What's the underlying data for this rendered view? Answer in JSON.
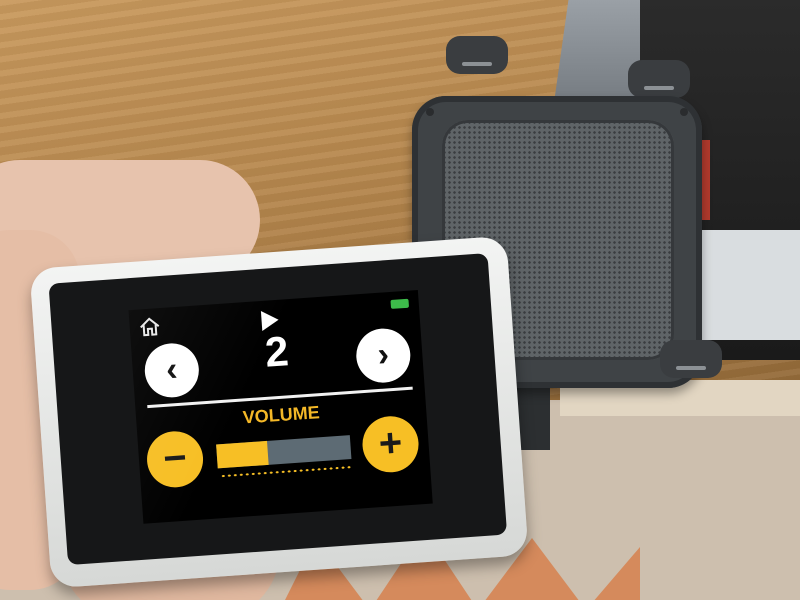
{
  "device_screen": {
    "track_number": "2",
    "volume_label": "VOLUME",
    "battery_label": "",
    "prev_symbol": "‹",
    "next_symbol": "›",
    "minus_symbol": "−",
    "plus_symbol": "+",
    "volume_level": 0.38,
    "icons": [
      "home-icon",
      "play-icon",
      "battery-icon",
      "chevron-left-icon",
      "chevron-right-icon",
      "minus-icon",
      "plus-icon"
    ]
  },
  "colors": {
    "accent_yellow": "#f7bf25",
    "volume_track": "#5d6b74",
    "battery_green": "#3dbb4a",
    "screen_bg": "#000000"
  }
}
